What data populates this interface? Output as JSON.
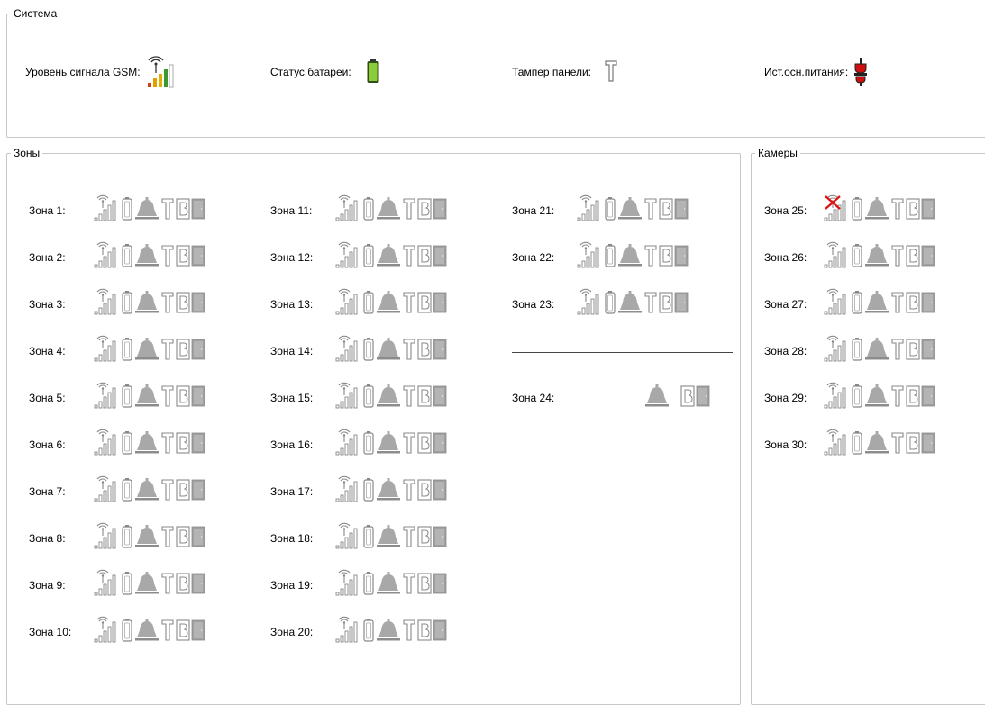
{
  "system": {
    "legend": "Система",
    "gsm_label": "Уровень сигнала GSM:",
    "battery_label": "Статус батареи:",
    "tamper_label": "Тампер панели:",
    "power_label": "Ист.осн.питания:",
    "colors": {
      "battery": "#7cc33a",
      "gsm_green": "#3c9a2c",
      "gsm_yellow": "#e0b000",
      "gsm_red": "#d0401a",
      "power_red": "#cc1010"
    }
  },
  "zones": {
    "legend": "Зоны",
    "col1": [
      "Зона 1:",
      "Зона 2:",
      "Зона 3:",
      "Зона 4:",
      "Зона 5:",
      "Зона 6:",
      "Зона 7:",
      "Зона 8:",
      "Зона 9:",
      "Зона 10:"
    ],
    "col2": [
      "Зона 11:",
      "Зона 12:",
      "Зона 13:",
      "Зона 14:",
      "Зона 15:",
      "Зона 16:",
      "Зона 17:",
      "Зона 18:",
      "Зона 19:",
      "Зона 20:"
    ],
    "col3": [
      "Зона 21:",
      "Зона 22:",
      "Зона 23:"
    ],
    "zone24": "Зона 24:",
    "icon_set": [
      "signal-icon",
      "battery-icon",
      "bell-icon",
      "tamper-icon",
      "bypass-icon",
      "door-icon"
    ]
  },
  "cameras": {
    "legend": "Камеры",
    "items": [
      "Зона 25:",
      "Зона 26:",
      "Зона 27:",
      "Зона 28:",
      "Зона 29:",
      "Зона 30:"
    ],
    "first_signal_state": "no-signal"
  }
}
